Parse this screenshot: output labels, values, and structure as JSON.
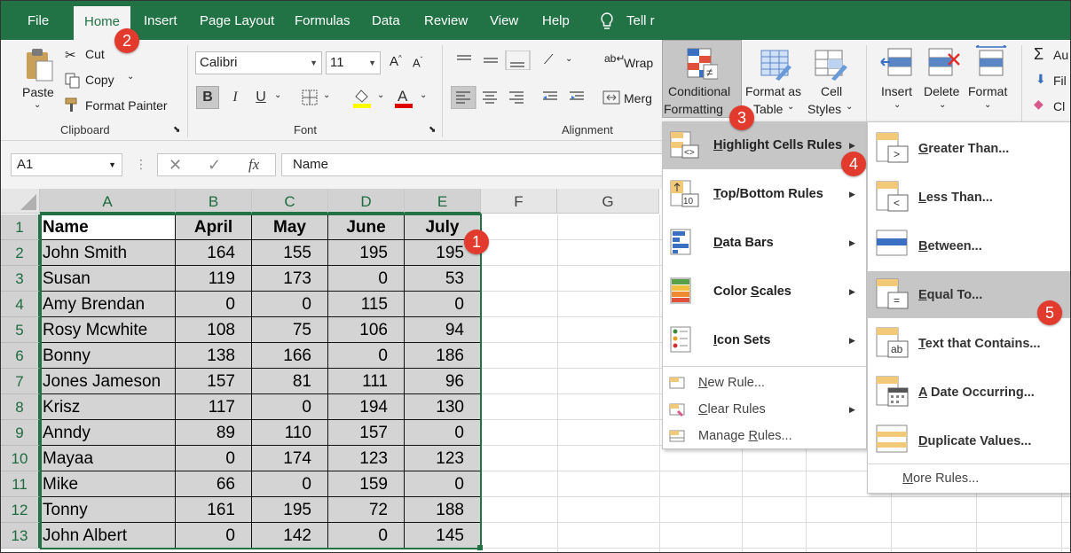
{
  "tabs": [
    {
      "label": "File",
      "active": false
    },
    {
      "label": "Home",
      "active": true
    },
    {
      "label": "Insert",
      "active": false
    },
    {
      "label": "Page Layout",
      "active": false
    },
    {
      "label": "Formulas",
      "active": false
    },
    {
      "label": "Data",
      "active": false
    },
    {
      "label": "Review",
      "active": false
    },
    {
      "label": "View",
      "active": false
    },
    {
      "label": "Help",
      "active": false
    }
  ],
  "tell_me": "Tell r",
  "clipboard": {
    "paste": "Paste",
    "cut": "Cut",
    "copy": "Copy",
    "format_painter": "Format Painter",
    "group": "Clipboard"
  },
  "font": {
    "family": "Calibri",
    "size": "11",
    "bold": "B",
    "italic": "I",
    "underline": "U",
    "group": "Font"
  },
  "alignment": {
    "wrap": "Wrap",
    "merge": "Merg",
    "group": "Alignment"
  },
  "styles": {
    "cond_line1": "Conditional",
    "cond_line2": "Formatting",
    "table_line1": "Format as",
    "table_line2": "Table",
    "cell_line1": "Cell",
    "cell_line2": "Styles"
  },
  "cells_group": {
    "insert": "Insert",
    "delete": "Delete",
    "format": "Format"
  },
  "editing": {
    "autosum": "Au",
    "fill": "Fil",
    "clear": "Cl"
  },
  "formula_bar": {
    "name_box": "A1",
    "fx": "fx",
    "content": "Name"
  },
  "columns": [
    "A",
    "B",
    "C",
    "D",
    "E",
    "F",
    "G"
  ],
  "rows": [
    "1",
    "2",
    "3",
    "4",
    "5",
    "6",
    "7",
    "8",
    "9",
    "10",
    "11",
    "12",
    "13"
  ],
  "table": {
    "headers": [
      "Name",
      "April",
      "May",
      "June",
      "July"
    ],
    "data": [
      [
        "John Smith",
        "164",
        "155",
        "195",
        "195"
      ],
      [
        "Susan",
        "119",
        "173",
        "0",
        "53"
      ],
      [
        "Amy Brendan",
        "0",
        "0",
        "115",
        "0"
      ],
      [
        "Rosy Mcwhite",
        "108",
        "75",
        "106",
        "94"
      ],
      [
        "Bonny",
        "138",
        "166",
        "0",
        "186"
      ],
      [
        "Jones Jameson",
        "157",
        "81",
        "111",
        "96"
      ],
      [
        "Krisz",
        "117",
        "0",
        "194",
        "130"
      ],
      [
        "Anndy",
        "89",
        "110",
        "157",
        "0"
      ],
      [
        "Mayaa",
        "0",
        "174",
        "123",
        "123"
      ],
      [
        "Mike",
        "66",
        "0",
        "159",
        "0"
      ],
      [
        "Tonny",
        "161",
        "195",
        "72",
        "188"
      ],
      [
        "John Albert",
        "0",
        "142",
        "0",
        "145"
      ]
    ]
  },
  "cf_menu": [
    {
      "label": "Highlight Cells Rules",
      "u": "H",
      "rest": "ighlight Cells Rules"
    },
    {
      "label": "Top/Bottom Rules",
      "u": "T",
      "rest": "op/Bottom Rules"
    },
    {
      "label": "Data Bars",
      "u": "D",
      "rest": "ata Bars"
    },
    {
      "label": "Color Scales",
      "pre": "Color ",
      "u": "S",
      "rest": "cales"
    },
    {
      "label": "Icon Sets",
      "u": "I",
      "rest": "con Sets"
    }
  ],
  "cf_small": [
    {
      "u": "N",
      "rest": "ew Rule..."
    },
    {
      "u": "C",
      "rest": "lear Rules"
    },
    {
      "pre": "Manage ",
      "u": "R",
      "rest": "ules..."
    }
  ],
  "hcr_menu": [
    {
      "u": "G",
      "rest": "reater Than..."
    },
    {
      "u": "L",
      "rest": "ess Than..."
    },
    {
      "u": "B",
      "rest": "etween..."
    },
    {
      "u": "E",
      "rest": "qual To..."
    },
    {
      "u": "T",
      "rest": "ext that Contains..."
    },
    {
      "u": "A",
      "rest": " Date Occurring..."
    },
    {
      "u": "D",
      "rest": "uplicate Values..."
    }
  ],
  "more_rules": {
    "u": "M",
    "rest": "ore Rules..."
  },
  "badges": [
    "1",
    "2",
    "3",
    "4",
    "5"
  ],
  "colors": {
    "excel_green": "#217346",
    "badge_red": "#e23b2e"
  }
}
